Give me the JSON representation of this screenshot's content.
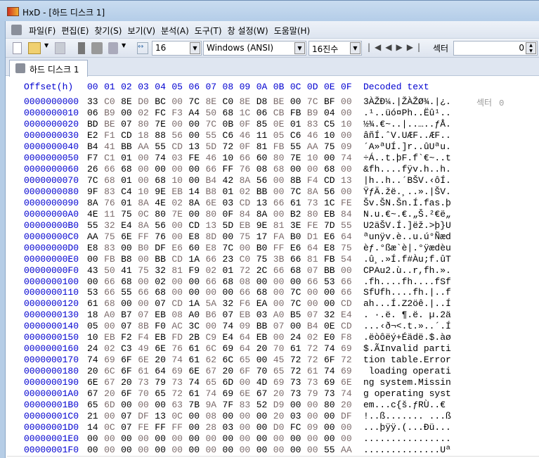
{
  "window": {
    "title": "HxD - [하드 디스크 1]"
  },
  "menu": [
    "파일(F)",
    "편집(E)",
    "찾기(S)",
    "보기(V)",
    "분석(A)",
    "도구(T)",
    "창 설정(W)",
    "도움말(H)"
  ],
  "toolbar": {
    "bytes_per_row": "16",
    "charset": "Windows (ANSI)",
    "offset_base": "16진수",
    "sector_label": "섹터",
    "sector_value": "0"
  },
  "tab": {
    "label": "하드 디스크 1"
  },
  "editor": {
    "offset_header": "Offset(h)",
    "column_headers": [
      "00",
      "01",
      "02",
      "03",
      "04",
      "05",
      "06",
      "07",
      "08",
      "09",
      "0A",
      "0B",
      "0C",
      "0D",
      "0E",
      "0F"
    ],
    "decoded_header": "Decoded text",
    "sector_marker": {
      "label": "섹터",
      "value": "0"
    },
    "rows": [
      {
        "offset": "0000000000",
        "bytes": "33 C0 8E D0 BC 00 7C 8E C0 8E D8 BE 00 7C BF 00",
        "text": "3ÀŽÐ¼.|ŽÀŽØ¾.|¿."
      },
      {
        "offset": "0000000010",
        "bytes": "06 B9 00 02 FC F3 A4 50 68 1C 06 CB FB B9 04 00",
        "text": ".¹..üó¤Ph..Ëû¹.."
      },
      {
        "offset": "0000000020",
        "bytes": "BD BE 07 80 7E 00 00 7C 0B 0F 85 0E 01 83 C5 10",
        "text": "½¾.€~..|..…..ƒÅ."
      },
      {
        "offset": "0000000030",
        "bytes": "E2 F1 CD 18 88 56 00 55 C6 46 11 05 C6 46 10 00",
        "text": "âñÍ.ˆV.UÆF..ÆF.."
      },
      {
        "offset": "0000000040",
        "bytes": "B4 41 BB AA 55 CD 13 5D 72 0F 81 FB 55 AA 75 09",
        "text": "´A»ªUÍ.]r..ûUªu."
      },
      {
        "offset": "0000000050",
        "bytes": "F7 C1 01 00 74 03 FE 46 10 66 60 80 7E 10 00 74",
        "text": "÷Á..t.þF.f`€~..t"
      },
      {
        "offset": "0000000060",
        "bytes": "26 66 68 00 00 00 00 66 FF 76 08 68 00 00 68 00",
        "text": "&fh....fÿv.h..h."
      },
      {
        "offset": "0000000070",
        "bytes": "7C 68 01 00 68 10 00 B4 42 8A 56 00 8B F4 CD 13",
        "text": "|h..h..´BŠV.‹ôÍ."
      },
      {
        "offset": "0000000080",
        "bytes": "9F 83 C4 10 9E EB 14 B8 01 02 BB 00 7C 8A 56 00",
        "text": "ŸƒÄ.žë.¸..».|ŠV."
      },
      {
        "offset": "0000000090",
        "bytes": "8A 76 01 8A 4E 02 8A 6E 03 CD 13 66 61 73 1C FE",
        "text": "Šv.ŠN.Šn.Í.fas.þ"
      },
      {
        "offset": "00000000A0",
        "bytes": "4E 11 75 0C 80 7E 00 80 0F 84 8A 00 B2 80 EB 84",
        "text": "N.u.€~.€.„Š.²€ë„"
      },
      {
        "offset": "00000000B0",
        "bytes": "55 32 E4 8A 56 00 CD 13 5D EB 9E 81 3E FE 7D 55",
        "text": "U2äŠV.Í.]ëž.>þ}U"
      },
      {
        "offset": "00000000C0",
        "bytes": "AA 75 6E FF 76 00 E8 8D 00 75 17 FA B0 D1 E6 64",
        "text": "ªunÿv.è..u.ú°Ñæd"
      },
      {
        "offset": "00000000D0",
        "bytes": "E8 83 00 B0 DF E6 60 E8 7C 00 B0 FF E6 64 E8 75",
        "text": "èƒ.°ßæ`è|.°ÿædèu"
      },
      {
        "offset": "00000000E0",
        "bytes": "00 FB B8 00 BB CD 1A 66 23 C0 75 3B 66 81 FB 54",
        "text": ".û¸.»Í.f#Àu;f.ûT"
      },
      {
        "offset": "00000000F0",
        "bytes": "43 50 41 75 32 81 F9 02 01 72 2C 66 68 07 BB 00",
        "text": "CPAu2.ù..r,fh.»."
      },
      {
        "offset": "0000000100",
        "bytes": "00 66 68 00 02 00 00 66 68 08 00 00 00 66 53 66",
        "text": ".fh....fh....fSf"
      },
      {
        "offset": "0000000110",
        "bytes": "53 66 55 66 68 00 00 00 00 66 68 00 7C 00 00 66",
        "text": "SfUfh....fh.|..f"
      },
      {
        "offset": "0000000120",
        "bytes": "61 68 00 00 07 CD 1A 5A 32 F6 EA 00 7C 00 00 CD",
        "text": "ah...Í.Z2öê.|..Í"
      },
      {
        "offset": "0000000130",
        "bytes": "18 A0 B7 07 EB 08 A0 B6 07 EB 03 A0 B5 07 32 E4",
        "text": ". ·.ë. ¶.ë. µ.2ä"
      },
      {
        "offset": "0000000140",
        "bytes": "05 00 07 8B F0 AC 3C 00 74 09 BB 07 00 B4 0E CD",
        "text": "...‹ð¬<.t.»..´.Í"
      },
      {
        "offset": "0000000150",
        "bytes": "10 EB F2 F4 EB FD 2B C9 E4 64 EB 00 24 02 E0 F8",
        "text": ".ëòôëý+Éädë.$.àø"
      },
      {
        "offset": "0000000160",
        "bytes": "24 02 C3 49 6E 76 61 6C 69 64 20 70 61 72 74 69",
        "text": "$.ÃInvalid parti"
      },
      {
        "offset": "0000000170",
        "bytes": "74 69 6F 6E 20 74 61 62 6C 65 00 45 72 72 6F 72",
        "text": "tion table.Error"
      },
      {
        "offset": "0000000180",
        "bytes": "20 6C 6F 61 64 69 6E 67 20 6F 70 65 72 61 74 69",
        "text": " loading operati"
      },
      {
        "offset": "0000000190",
        "bytes": "6E 67 20 73 79 73 74 65 6D 00 4D 69 73 73 69 6E",
        "text": "ng system.Missin"
      },
      {
        "offset": "00000001A0",
        "bytes": "67 20 6F 70 65 72 61 74 69 6E 67 20 73 79 73 74",
        "text": "g operating syst"
      },
      {
        "offset": "00000001B0",
        "bytes": "65 6D 00 00 00 63 7B 9A 7F 83 52 D9 00 00 80 20",
        "text": "em...c{š.ƒRÙ..€ "
      },
      {
        "offset": "00000001C0",
        "bytes": "21 00 07 DF 13 0C 00 08 00 00 00 20 03 00 00 DF",
        "text": "!..ß....... ...ß"
      },
      {
        "offset": "00000001D0",
        "bytes": "14 0C 07 FE FF FF 00 28 03 00 00 D0 FC 09 00 00",
        "text": "...þÿÿ.(...Ðü..."
      },
      {
        "offset": "00000001E0",
        "bytes": "00 00 00 00 00 00 00 00 00 00 00 00 00 00 00 00",
        "text": "................"
      },
      {
        "offset": "00000001F0",
        "bytes": "00 00 00 00 00 00 00 00 00 00 00 00 00 00 55 AA",
        "text": "..............Uª"
      }
    ]
  }
}
